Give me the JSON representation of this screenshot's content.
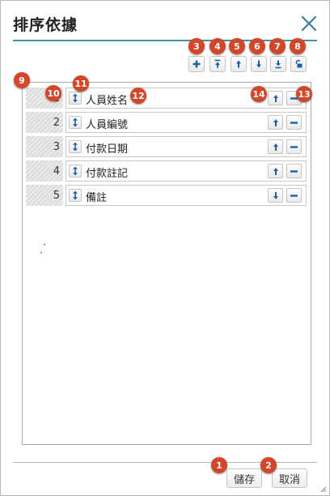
{
  "dialog": {
    "title": "排序依據",
    "close_icon": "close-icon"
  },
  "toolbar": {
    "buttons": [
      {
        "name": "add-button",
        "icon": "plus-icon"
      },
      {
        "name": "move-top-button",
        "icon": "arrow-to-top-icon"
      },
      {
        "name": "move-up-button",
        "icon": "arrow-up-icon"
      },
      {
        "name": "move-down-button",
        "icon": "arrow-down-icon"
      },
      {
        "name": "move-bottom-button",
        "icon": "arrow-to-bottom-icon"
      },
      {
        "name": "unlock-button",
        "icon": "unlock-icon"
      }
    ]
  },
  "sort_rows": [
    {
      "index": "1",
      "label": "人員姓名",
      "move_icon": "arrow-up-icon"
    },
    {
      "index": "2",
      "label": "人員編號",
      "move_icon": "arrow-up-icon"
    },
    {
      "index": "3",
      "label": "付款日期",
      "move_icon": "arrow-up-icon"
    },
    {
      "index": "4",
      "label": "付款註記",
      "move_icon": "arrow-up-icon"
    },
    {
      "index": "5",
      "label": "備註",
      "move_icon": "arrow-down-icon"
    }
  ],
  "footer": {
    "save_label": "儲存",
    "cancel_label": "取消"
  },
  "annotations": {
    "badges": [
      "1",
      "2",
      "3",
      "4",
      "5",
      "6",
      "7",
      "8",
      "9",
      "10",
      "11",
      "12",
      "13",
      "14"
    ],
    "color": "#d2462a"
  },
  "colors": {
    "accent_rule": "#4f8fa6",
    "icon_blue": "#1f5fa8"
  }
}
